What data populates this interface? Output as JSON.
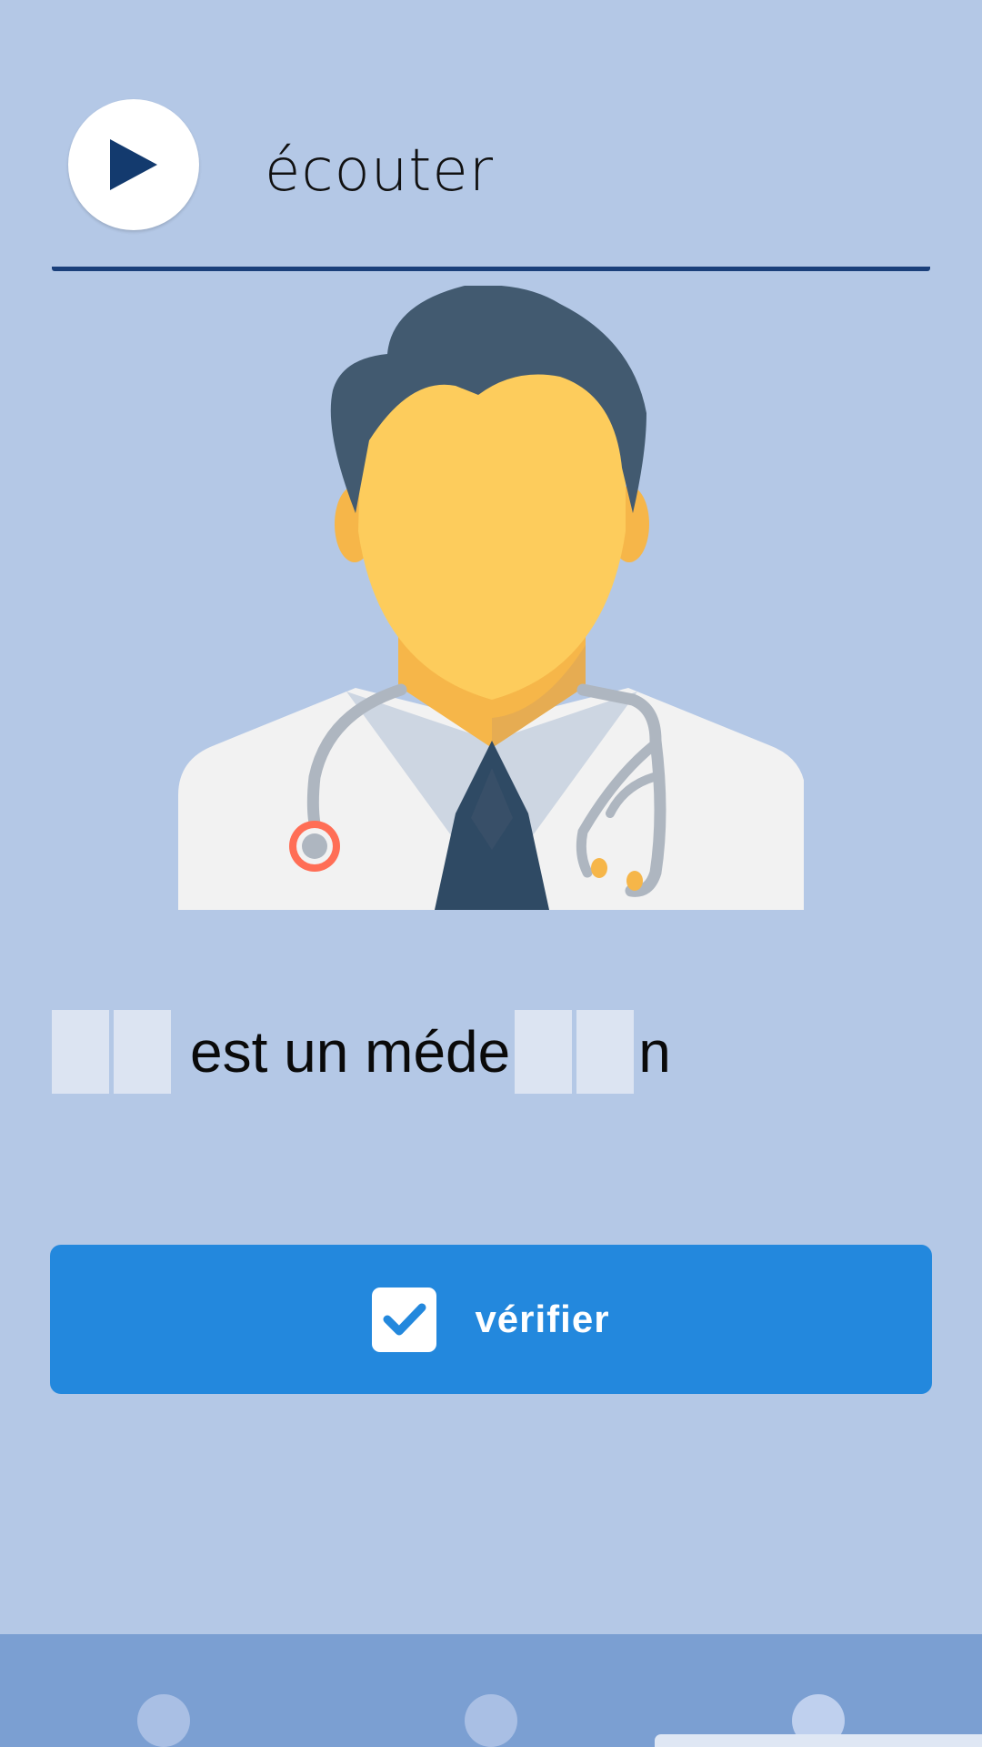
{
  "listen": {
    "label": "écouter",
    "icon": "play-icon"
  },
  "illustration": {
    "subject": "doctor-icon",
    "colors": {
      "hair": "#425a70",
      "skin": "#fdcc5c",
      "skin_shadow": "#f6b649",
      "coat": "#f2f2f2",
      "collar": "#cdd6e2",
      "tie": "#2f4a64",
      "stethoscope": "#aeb6c0",
      "stethoscope_ring": "#ff6e56"
    }
  },
  "sentence": {
    "part_middle": "est un méde",
    "part_end": "n",
    "blank_slots_before": 2,
    "blank_slots_inside": 2
  },
  "verify": {
    "label": "vérifier",
    "icon": "checkbox-check-icon"
  },
  "nav": {
    "dots": 3
  },
  "colors": {
    "background": "#b4c8e6",
    "accent": "#2388dd",
    "nav_bar": "#7b9fd2",
    "underline": "#1a3f7a"
  }
}
